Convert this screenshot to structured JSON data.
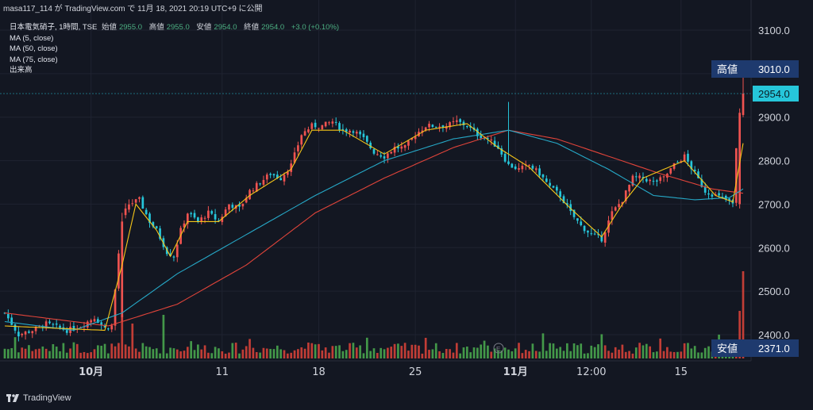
{
  "header": {
    "publisher_line": "masa117_114 が TradingView.com で 11月 18, 2021 20:19 UTC+9 に公開"
  },
  "legend": {
    "symbol": "日本電気硝子, 1時間, TSE",
    "open_label": "始値",
    "open": "2955.0",
    "high_label": "高値",
    "high": "2955.0",
    "low_label": "安値",
    "low": "2954.0",
    "close_label": "終値",
    "close": "2954.0",
    "change": "+3.0 (+0.10%)",
    "ma5": "MA (5, close)",
    "ma50": "MA (50, close)",
    "ma75": "MA (75, close)",
    "volume": "出来高"
  },
  "badges": {
    "high_label": "高値",
    "high_value": "3010.0",
    "last_value": "2954.0",
    "low_label": "安値",
    "low_value": "2371.0"
  },
  "footer": {
    "brand": "TradingView"
  },
  "colors": {
    "background": "#131722",
    "up": "#ef5350",
    "down": "#26c6da",
    "ma5": "#f5c518",
    "ma50": "#26a8c7",
    "ma75": "#e0443a",
    "vol_up": "#e0443a",
    "vol_down": "#4caf50",
    "badge_bg": "#1e3a6e",
    "last_bg": "#26c6da"
  },
  "chart_data": {
    "type": "candlestick",
    "y_range": [
      2350,
      3140
    ],
    "y_ticks": [
      "3100.0",
      "3000.0",
      "2900.0",
      "2800.0",
      "2700.0",
      "2600.0",
      "2500.0",
      "2400.0"
    ],
    "x_tick_labels": [
      "10月",
      "11",
      "18",
      "25",
      "11月",
      "12:00",
      "15"
    ],
    "price_path": [
      {
        "t": 0,
        "p": 2450
      },
      {
        "t": 4,
        "p": 2400
      },
      {
        "t": 8,
        "p": 2410
      },
      {
        "t": 12,
        "p": 2425
      },
      {
        "t": 18,
        "p": 2410
      },
      {
        "t": 22,
        "p": 2420
      },
      {
        "t": 26,
        "p": 2440
      },
      {
        "t": 29,
        "p": 2415
      },
      {
        "t": 31,
        "p": 2420
      },
      {
        "t": 34,
        "p": 2670
      },
      {
        "t": 36,
        "p": 2700
      },
      {
        "t": 39,
        "p": 2710
      },
      {
        "t": 42,
        "p": 2660
      },
      {
        "t": 44,
        "p": 2640
      },
      {
        "t": 47,
        "p": 2590
      },
      {
        "t": 49,
        "p": 2580
      },
      {
        "t": 51,
        "p": 2640
      },
      {
        "t": 53,
        "p": 2680
      },
      {
        "t": 56,
        "p": 2660
      },
      {
        "t": 59,
        "p": 2680
      },
      {
        "t": 62,
        "p": 2660
      },
      {
        "t": 65,
        "p": 2700
      },
      {
        "t": 68,
        "p": 2690
      },
      {
        "t": 71,
        "p": 2730
      },
      {
        "t": 74,
        "p": 2750
      },
      {
        "t": 77,
        "p": 2770
      },
      {
        "t": 80,
        "p": 2760
      },
      {
        "t": 83,
        "p": 2790
      },
      {
        "t": 86,
        "p": 2860
      },
      {
        "t": 89,
        "p": 2880
      },
      {
        "t": 92,
        "p": 2880
      },
      {
        "t": 95,
        "p": 2890
      },
      {
        "t": 98,
        "p": 2870
      },
      {
        "t": 101,
        "p": 2870
      },
      {
        "t": 104,
        "p": 2850
      },
      {
        "t": 107,
        "p": 2820
      },
      {
        "t": 110,
        "p": 2810
      },
      {
        "t": 113,
        "p": 2830
      },
      {
        "t": 116,
        "p": 2830
      },
      {
        "t": 119,
        "p": 2860
      },
      {
        "t": 122,
        "p": 2880
      },
      {
        "t": 125,
        "p": 2880
      },
      {
        "t": 128,
        "p": 2880
      },
      {
        "t": 131,
        "p": 2890
      },
      {
        "t": 134,
        "p": 2880
      },
      {
        "t": 137,
        "p": 2860
      },
      {
        "t": 140,
        "p": 2850
      },
      {
        "t": 143,
        "p": 2830
      },
      {
        "t": 146,
        "p": 2790
      },
      {
        "t": 149,
        "p": 2780
      },
      {
        "t": 152,
        "p": 2790
      },
      {
        "t": 155,
        "p": 2770
      },
      {
        "t": 158,
        "p": 2740
      },
      {
        "t": 161,
        "p": 2720
      },
      {
        "t": 164,
        "p": 2680
      },
      {
        "t": 167,
        "p": 2650
      },
      {
        "t": 170,
        "p": 2630
      },
      {
        "t": 173,
        "p": 2620
      },
      {
        "t": 176,
        "p": 2680
      },
      {
        "t": 179,
        "p": 2710
      },
      {
        "t": 182,
        "p": 2760
      },
      {
        "t": 185,
        "p": 2760
      },
      {
        "t": 188,
        "p": 2750
      },
      {
        "t": 191,
        "p": 2760
      },
      {
        "t": 194,
        "p": 2790
      },
      {
        "t": 197,
        "p": 2810
      },
      {
        "t": 200,
        "p": 2770
      },
      {
        "t": 203,
        "p": 2730
      },
      {
        "t": 206,
        "p": 2720
      },
      {
        "t": 209,
        "p": 2710
      },
      {
        "t": 211,
        "p": 2700
      },
      {
        "t": 213,
        "p": 2950
      },
      {
        "t": 214,
        "p": 2954
      }
    ],
    "ma5_path": [
      {
        "t": 0,
        "p": 2420
      },
      {
        "t": 29,
        "p": 2410
      },
      {
        "t": 34,
        "p": 2560
      },
      {
        "t": 38,
        "p": 2700
      },
      {
        "t": 44,
        "p": 2640
      },
      {
        "t": 48,
        "p": 2580
      },
      {
        "t": 53,
        "p": 2660
      },
      {
        "t": 62,
        "p": 2660
      },
      {
        "t": 71,
        "p": 2720
      },
      {
        "t": 83,
        "p": 2780
      },
      {
        "t": 89,
        "p": 2870
      },
      {
        "t": 98,
        "p": 2870
      },
      {
        "t": 110,
        "p": 2815
      },
      {
        "t": 122,
        "p": 2870
      },
      {
        "t": 134,
        "p": 2885
      },
      {
        "t": 143,
        "p": 2830
      },
      {
        "t": 152,
        "p": 2785
      },
      {
        "t": 164,
        "p": 2690
      },
      {
        "t": 173,
        "p": 2625
      },
      {
        "t": 179,
        "p": 2700
      },
      {
        "t": 185,
        "p": 2760
      },
      {
        "t": 197,
        "p": 2800
      },
      {
        "t": 206,
        "p": 2720
      },
      {
        "t": 211,
        "p": 2705
      },
      {
        "t": 214,
        "p": 2840
      }
    ],
    "ma50_path": [
      {
        "t": 0,
        "p": 2430
      },
      {
        "t": 20,
        "p": 2410
      },
      {
        "t": 34,
        "p": 2450
      },
      {
        "t": 50,
        "p": 2540
      },
      {
        "t": 70,
        "p": 2630
      },
      {
        "t": 90,
        "p": 2720
      },
      {
        "t": 110,
        "p": 2800
      },
      {
        "t": 130,
        "p": 2850
      },
      {
        "t": 146,
        "p": 2870
      },
      {
        "t": 160,
        "p": 2840
      },
      {
        "t": 175,
        "p": 2780
      },
      {
        "t": 188,
        "p": 2720
      },
      {
        "t": 200,
        "p": 2710
      },
      {
        "t": 210,
        "p": 2715
      },
      {
        "t": 214,
        "p": 2735
      }
    ],
    "ma75_path": [
      {
        "t": 0,
        "p": 2450
      },
      {
        "t": 30,
        "p": 2420
      },
      {
        "t": 50,
        "p": 2470
      },
      {
        "t": 70,
        "p": 2560
      },
      {
        "t": 90,
        "p": 2680
      },
      {
        "t": 110,
        "p": 2760
      },
      {
        "t": 130,
        "p": 2830
      },
      {
        "t": 146,
        "p": 2870
      },
      {
        "t": 160,
        "p": 2850
      },
      {
        "t": 175,
        "p": 2810
      },
      {
        "t": 190,
        "p": 2770
      },
      {
        "t": 205,
        "p": 2735
      },
      {
        "t": 214,
        "p": 2725
      }
    ]
  }
}
